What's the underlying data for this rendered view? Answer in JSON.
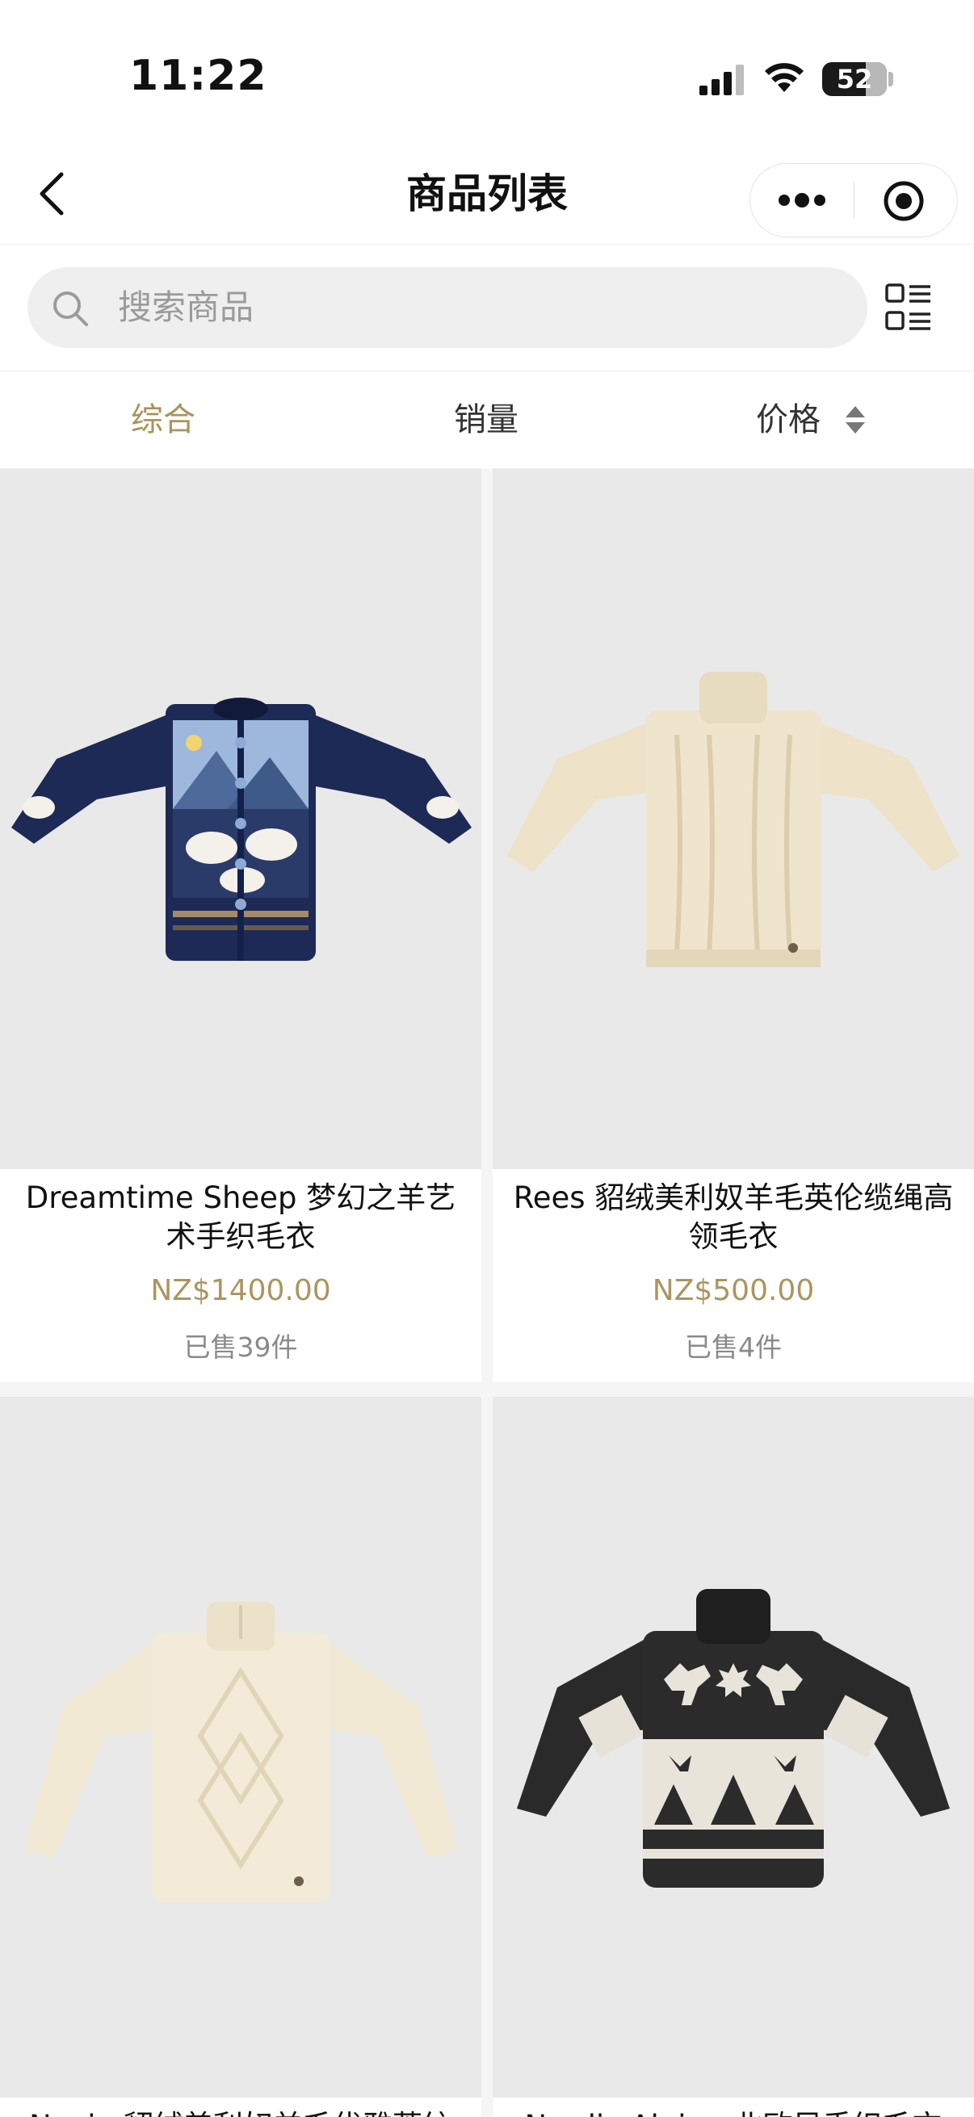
{
  "status_bar": {
    "time": "11:22",
    "battery": "52"
  },
  "nav": {
    "title": "商品列表"
  },
  "search": {
    "placeholder": "搜索商品"
  },
  "sort_tabs": {
    "comprehensive": "综合",
    "sales": "销量",
    "price": "价格"
  },
  "colors": {
    "accent": "#a9925b",
    "price": "#ab9560",
    "sweater_navy": "#1c2a55",
    "sweater_cream": "#efe4cc"
  },
  "products": [
    {
      "name": "Dreamtime Sheep 梦幻之羊艺术手织毛衣",
      "price": "NZ$1400.00",
      "sold": "已售39件"
    },
    {
      "name": "Rees 貂绒美利奴羊毛英伦缆绳高领毛衣",
      "price": "NZ$500.00",
      "sold": "已售4件"
    },
    {
      "name": "Navio 貂绒美利奴羊毛优雅菱纹",
      "price": "",
      "sold": ""
    },
    {
      "name": "Nordic Alpine 北欧风手织毛衣",
      "price": "",
      "sold": ""
    }
  ]
}
